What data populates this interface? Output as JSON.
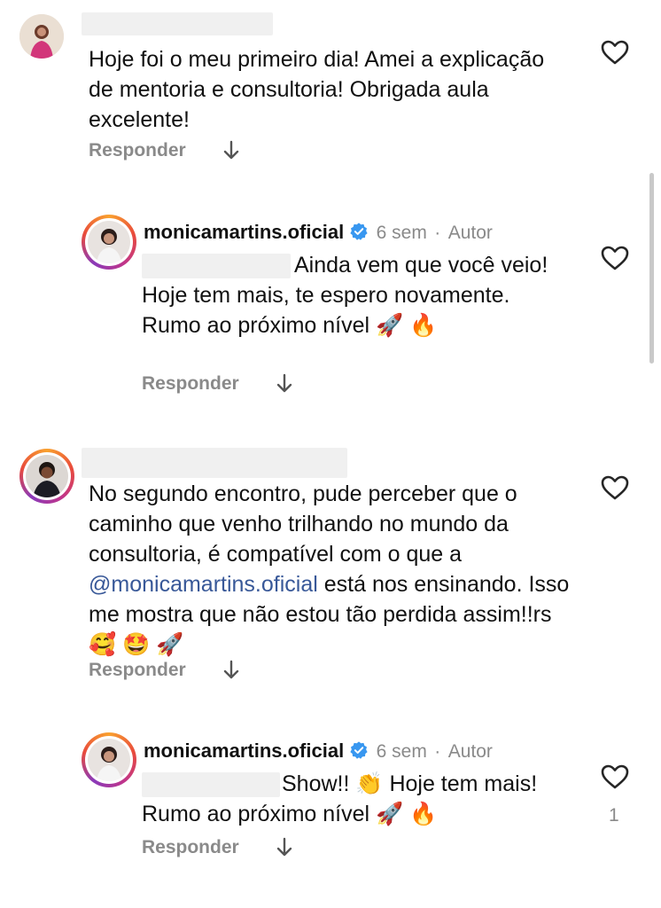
{
  "comments": [
    {
      "text": "Hoje foi o meu primeiro dia! Amei a explicação de mentoria e consultoria! Obrigada aula excelente!",
      "reply_label": "Responder"
    },
    {
      "username": "monicamartins.oficial",
      "time": "6 sem",
      "separator": "·",
      "role": "Autor",
      "text": "Ainda vem que você veio! Hoje tem mais, te espero novamente. Rumo ao próximo nível 🚀 🔥",
      "reply_label": "Responder"
    },
    {
      "text_before": "No segundo encontro, pude perceber que o caminho que venho trilhando no mundo da consultoria, é compatível com o que a",
      "mention": "@monicamartins.oficial",
      "text_after": "está nos ensinando. Isso me mostra que não estou tão perdida assim!!rs 🥰 🤩 🚀",
      "reply_label": "Responder"
    },
    {
      "username": "monicamartins.oficial",
      "time": "6 sem",
      "separator": "·",
      "role": "Autor",
      "text": "Show!! 👏 Hoje tem mais! Rumo ao próximo nível 🚀 🔥",
      "reply_label": "Responder",
      "like_count": "1"
    }
  ],
  "icons": {
    "like": "heart-outline-icon",
    "expand": "arrow-down-icon",
    "verified": "verified-badge-icon"
  },
  "colors": {
    "verified": "#3897f0",
    "secondary_text": "#8a8a8a",
    "mention": "#385898"
  }
}
